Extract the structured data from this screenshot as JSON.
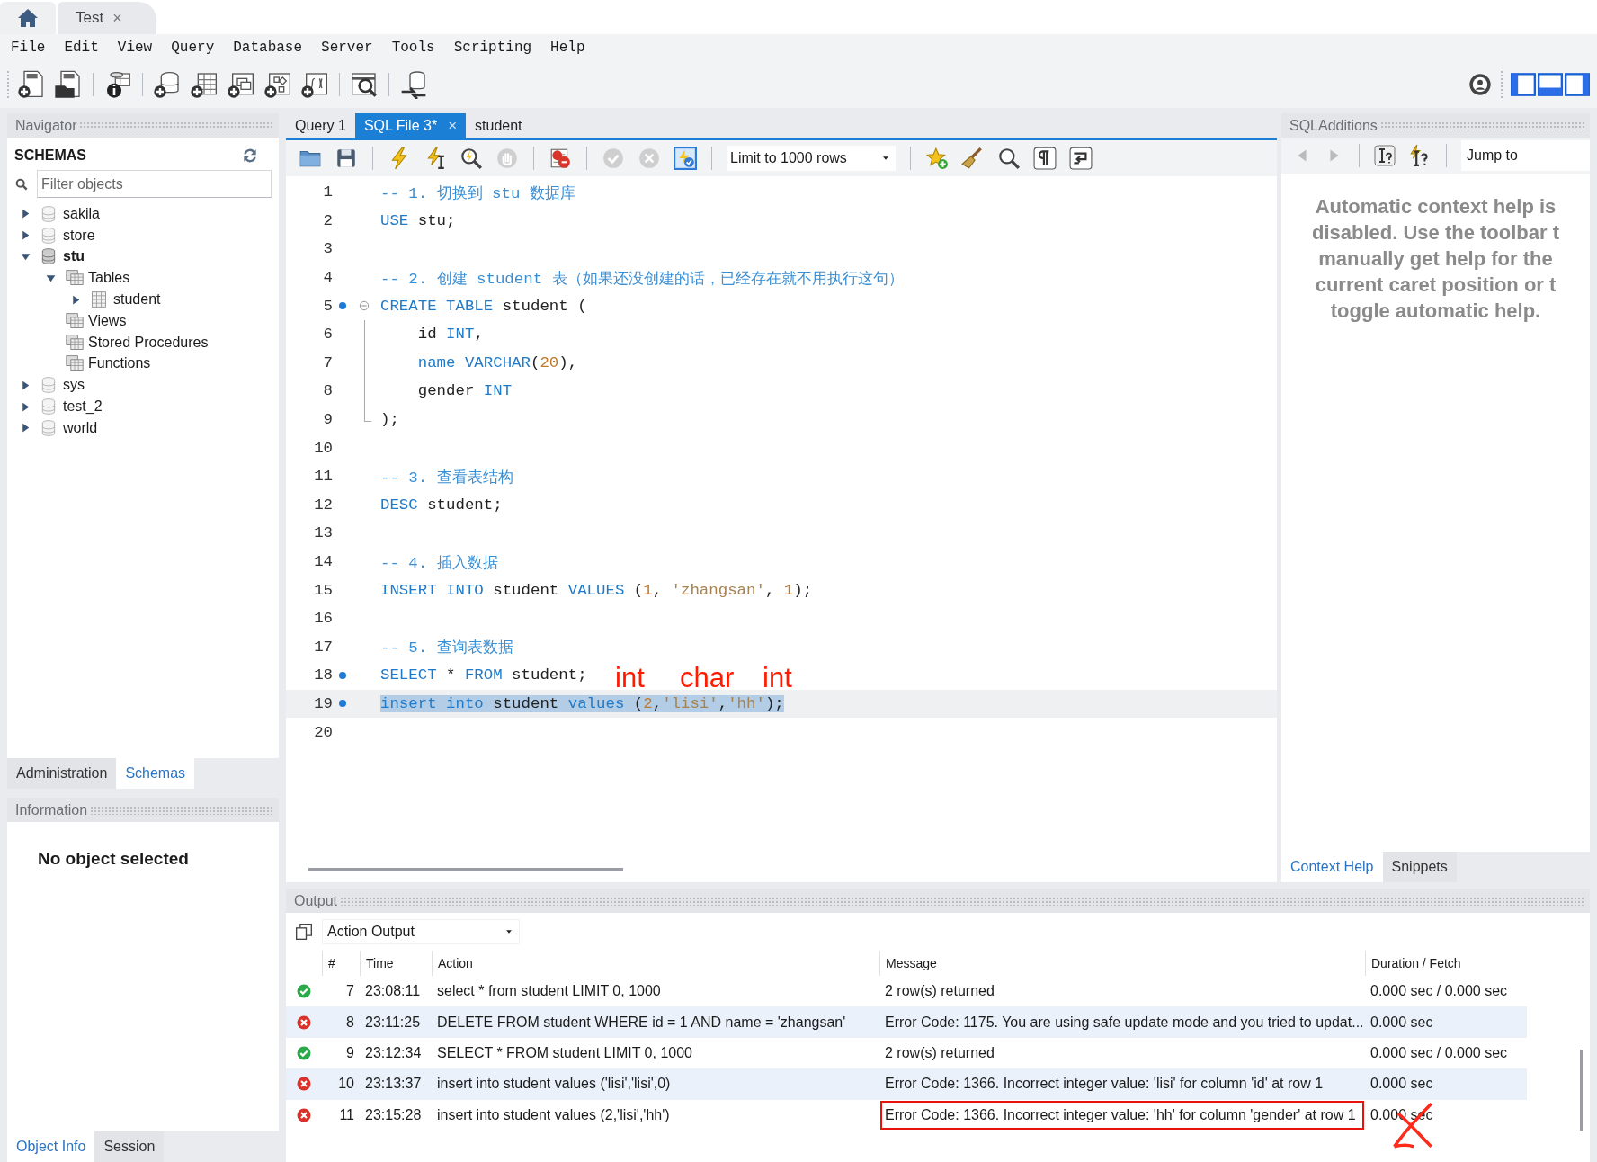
{
  "connection_tab": {
    "label": "Test",
    "close": "×",
    "selected": true
  },
  "menu": [
    "File",
    "Edit",
    "View",
    "Query",
    "Database",
    "Server",
    "Tools",
    "Scripting",
    "Help"
  ],
  "navigator": {
    "title": "Navigator",
    "section": "SCHEMAS",
    "filter": {
      "placeholder": "Filter objects"
    },
    "tree": [
      {
        "label": "sakila",
        "kind": "schema",
        "expanded": false,
        "default": false
      },
      {
        "label": "store",
        "kind": "schema",
        "expanded": false,
        "default": false
      },
      {
        "label": "stu",
        "kind": "schema",
        "expanded": true,
        "default": true,
        "children": [
          {
            "label": "Tables",
            "kind": "folder",
            "expanded": true,
            "children": [
              {
                "label": "student",
                "kind": "table",
                "expanded": false
              }
            ]
          },
          {
            "label": "Views",
            "kind": "folder"
          },
          {
            "label": "Stored Procedures",
            "kind": "folder"
          },
          {
            "label": "Functions",
            "kind": "folder"
          }
        ]
      },
      {
        "label": "sys",
        "kind": "schema",
        "expanded": false,
        "default": false
      },
      {
        "label": "test_2",
        "kind": "schema",
        "expanded": false,
        "default": false
      },
      {
        "label": "world",
        "kind": "schema",
        "expanded": false,
        "default": false
      }
    ]
  },
  "navigator_tabs": [
    {
      "label": "Administration",
      "selected": false
    },
    {
      "label": "Schemas",
      "selected": true
    }
  ],
  "information": {
    "title": "Information",
    "message": "No object selected"
  },
  "information_tabs": [
    {
      "label": "Object Info",
      "selected": true
    },
    {
      "label": "Session",
      "selected": false
    }
  ],
  "editor_tabs": [
    {
      "label": "Query 1",
      "selected": false
    },
    {
      "label": "SQL File 3*",
      "selected": true,
      "close": "×"
    },
    {
      "label": "student",
      "selected": false
    }
  ],
  "limit_dropdown": {
    "value": "Limit to 1000 rows"
  },
  "code_lines": [
    {
      "number": "1",
      "marker": false,
      "fold_start": false,
      "in_fold": false,
      "selected": false,
      "tokens": [
        {
          "kind": "comment",
          "text": "-- 1. 切换到 stu 数据库"
        }
      ]
    },
    {
      "number": "2",
      "marker": false,
      "fold_start": false,
      "in_fold": false,
      "selected": false,
      "tokens": [
        {
          "kind": "keyword",
          "text": "USE"
        },
        {
          "kind": "plain",
          "text": " stu;"
        }
      ]
    },
    {
      "number": "3",
      "marker": false,
      "fold_start": false,
      "in_fold": false,
      "selected": false
    },
    {
      "number": "4",
      "marker": false,
      "fold_start": false,
      "in_fold": false,
      "selected": false,
      "tokens": [
        {
          "kind": "comment",
          "text": "-- 2. 创建 student 表（如果还没创建的话，已经存在就不用执行这句）"
        }
      ]
    },
    {
      "number": "5",
      "marker": true,
      "fold_start": true,
      "in_fold": false,
      "selected": false,
      "tokens": [
        {
          "kind": "keyword",
          "text": "CREATE TABLE"
        },
        {
          "kind": "plain",
          "text": " student ("
        }
      ]
    },
    {
      "number": "6",
      "marker": false,
      "fold_start": false,
      "in_fold": true,
      "selected": false,
      "tokens": [
        {
          "kind": "plain",
          "text": "    id "
        },
        {
          "kind": "keyword",
          "text": "INT"
        },
        {
          "kind": "plain",
          "text": ","
        }
      ]
    },
    {
      "number": "7",
      "marker": false,
      "fold_start": false,
      "in_fold": true,
      "selected": false,
      "tokens": [
        {
          "kind": "keyword",
          "text": "    name"
        },
        {
          "kind": "keyword",
          "text": " VARCHAR"
        },
        {
          "kind": "plain",
          "text": "("
        },
        {
          "kind": "number",
          "text": "20"
        },
        {
          "kind": "plain",
          "text": "),"
        }
      ]
    },
    {
      "number": "8",
      "marker": false,
      "fold_start": false,
      "in_fold": true,
      "selected": false,
      "tokens": [
        {
          "kind": "plain",
          "text": "    gender "
        },
        {
          "kind": "keyword",
          "text": "INT"
        }
      ]
    },
    {
      "number": "9",
      "marker": false,
      "fold_start": false,
      "in_fold": true,
      "selected": false,
      "tokens": [
        {
          "kind": "plain",
          "text": ");"
        }
      ]
    },
    {
      "number": "10",
      "marker": false,
      "fold_start": false,
      "in_fold": false,
      "selected": false
    },
    {
      "number": "11",
      "marker": false,
      "fold_start": false,
      "in_fold": false,
      "selected": false,
      "tokens": [
        {
          "kind": "comment",
          "text": "-- 3. 查看表结构"
        }
      ]
    },
    {
      "number": "12",
      "marker": false,
      "fold_start": false,
      "in_fold": false,
      "selected": false,
      "tokens": [
        {
          "kind": "keyword",
          "text": "DESC"
        },
        {
          "kind": "plain",
          "text": " student;"
        }
      ]
    },
    {
      "number": "13",
      "marker": false,
      "fold_start": false,
      "in_fold": false,
      "selected": false
    },
    {
      "number": "14",
      "marker": false,
      "fold_start": false,
      "in_fold": false,
      "selected": false,
      "tokens": [
        {
          "kind": "comment",
          "text": "-- 4. 插入数据"
        }
      ]
    },
    {
      "number": "15",
      "marker": false,
      "fold_start": false,
      "in_fold": false,
      "selected": false,
      "tokens": [
        {
          "kind": "keyword",
          "text": "INSERT INTO"
        },
        {
          "kind": "plain",
          "text": " student "
        },
        {
          "kind": "keyword",
          "text": "VALUES"
        },
        {
          "kind": "plain",
          "text": " ("
        },
        {
          "kind": "number",
          "text": "1"
        },
        {
          "kind": "plain",
          "text": ", "
        },
        {
          "kind": "string",
          "text": "'zhangsan'"
        },
        {
          "kind": "plain",
          "text": ", "
        },
        {
          "kind": "number",
          "text": "1"
        },
        {
          "kind": "plain",
          "text": ");"
        }
      ]
    },
    {
      "number": "16",
      "marker": false,
      "fold_start": false,
      "in_fold": false,
      "selected": false
    },
    {
      "number": "17",
      "marker": false,
      "fold_start": false,
      "in_fold": false,
      "selected": false,
      "tokens": [
        {
          "kind": "comment",
          "text": "-- 5. 查询表数据"
        }
      ]
    },
    {
      "number": "18",
      "marker": true,
      "fold_start": false,
      "in_fold": false,
      "selected": false,
      "tokens": [
        {
          "kind": "keyword",
          "text": "SELECT"
        },
        {
          "kind": "plain",
          "text": " * "
        },
        {
          "kind": "keyword",
          "text": "FROM"
        },
        {
          "kind": "plain",
          "text": " student;"
        }
      ]
    },
    {
      "number": "19",
      "marker": true,
      "fold_start": false,
      "in_fold": false,
      "selected": true,
      "tokens": [
        {
          "kind": "keyword",
          "text": "insert into"
        },
        {
          "kind": "plain",
          "text": " student "
        },
        {
          "kind": "keyword",
          "text": "values"
        },
        {
          "kind": "plain",
          "text": " ("
        },
        {
          "kind": "number",
          "text": "2"
        },
        {
          "kind": "plain",
          "text": ","
        },
        {
          "kind": "string",
          "text": "'lisi'"
        },
        {
          "kind": "plain",
          "text": ","
        },
        {
          "kind": "string",
          "text": "'hh'"
        },
        {
          "kind": "plain",
          "text": ");"
        }
      ]
    },
    {
      "number": "20",
      "marker": false,
      "fold_start": false,
      "in_fold": false,
      "selected": false
    }
  ],
  "annotations": [
    {
      "text": "int"
    },
    {
      "text": "char"
    },
    {
      "text": "int"
    }
  ],
  "sql_additions": {
    "title": "SQLAdditions",
    "jump_to": "Jump to",
    "help_lines": [
      "Automatic context help is",
      "disabled. Use the toolbar t",
      "manually get help for the",
      "current caret position or t",
      "toggle automatic help."
    ]
  },
  "sql_additions_tabs": [
    {
      "label": "Context Help",
      "selected": true
    },
    {
      "label": "Snippets",
      "selected": false
    }
  ],
  "output": {
    "title": "Output",
    "mode": "Action Output",
    "columns": [
      "#",
      "Time",
      "Action",
      "Message",
      "Duration / Fetch"
    ],
    "rows": [
      {
        "kind": "ok",
        "number": "7",
        "time": "23:08:11",
        "action": "select * from student LIMIT 0, 1000",
        "message": "2 row(s) returned",
        "duration": "0.000 sec / 0.000 sec",
        "boxed": false,
        "crossed_out": false
      },
      {
        "kind": "error",
        "number": "8",
        "time": "23:11:25",
        "action": "DELETE FROM student WHERE id = 1 AND name = 'zhangsan'",
        "message": "Error Code: 1175. You are using safe update mode and you tried to updat...",
        "duration": "0.000 sec",
        "boxed": false,
        "crossed_out": false
      },
      {
        "kind": "ok",
        "number": "9",
        "time": "23:12:34",
        "action": "SELECT * FROM student LIMIT 0, 1000",
        "message": "2 row(s) returned",
        "duration": "0.000 sec / 0.000 sec",
        "boxed": false,
        "crossed_out": false
      },
      {
        "kind": "error",
        "number": "10",
        "time": "23:13:37",
        "action": "insert into student values ('lisi','lisi',0)",
        "message": "Error Code: 1366. Incorrect integer value: 'lisi' for column 'id' at row 1",
        "duration": "0.000 sec",
        "boxed": false,
        "crossed_out": false
      },
      {
        "kind": "error",
        "number": "11",
        "time": "23:15:28",
        "action": "insert into student values (2,'lisi','hh')",
        "message": "Error Code: 1366. Incorrect integer value: 'hh' for column 'gender' at row 1",
        "duration": "0.000 sec",
        "boxed": true,
        "crossed_out": true
      }
    ]
  }
}
